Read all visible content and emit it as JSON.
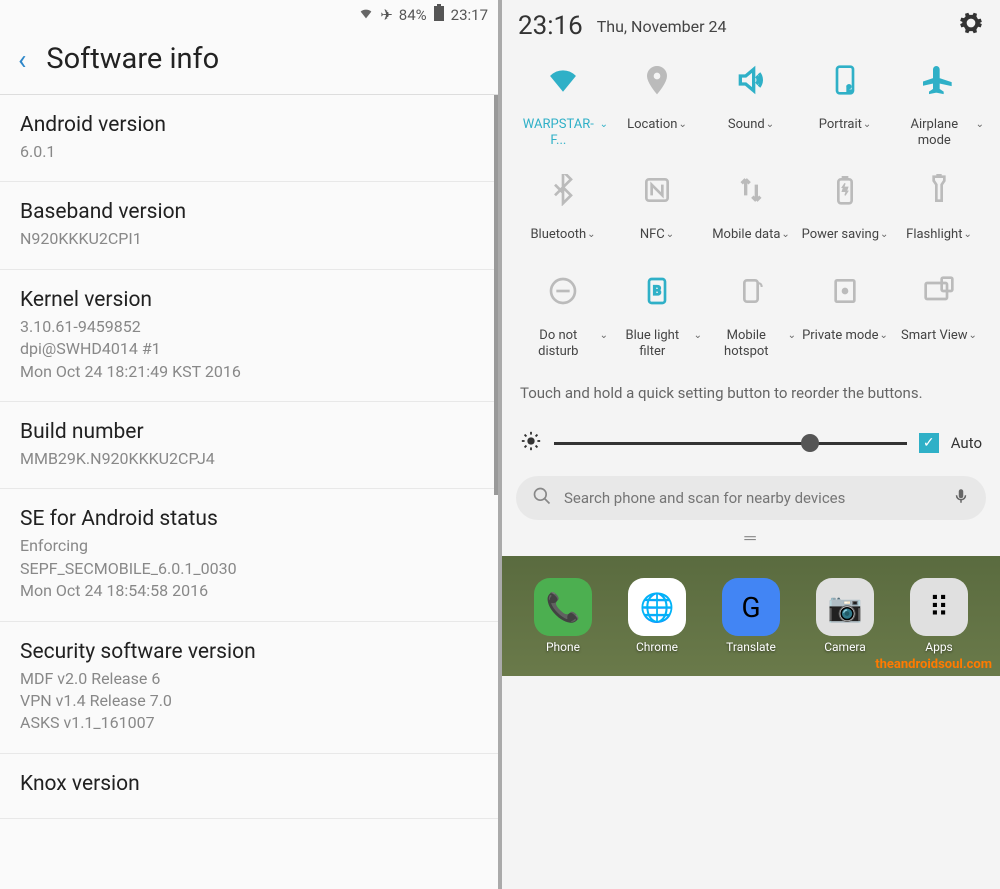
{
  "left": {
    "status": {
      "battery": "84%",
      "time": "23:17"
    },
    "title": "Software info",
    "items": [
      {
        "label": "Android version",
        "value": "6.0.1"
      },
      {
        "label": "Baseband version",
        "value": "N920KKKU2CPI1"
      },
      {
        "label": "Kernel version",
        "value": "3.10.61-9459852\ndpi@SWHD4014 #1\nMon Oct 24 18:21:49 KST 2016"
      },
      {
        "label": "Build number",
        "value": "MMB29K.N920KKKU2CPJ4"
      },
      {
        "label": "SE for Android status",
        "value": "Enforcing\nSEPF_SECMOBILE_6.0.1_0030\nMon Oct 24 18:54:58 2016"
      },
      {
        "label": "Security software version",
        "value": "MDF v2.0 Release 6\nVPN v1.4 Release 7.0\nASKS v1.1_161007"
      },
      {
        "label": "Knox version",
        "value": ""
      }
    ]
  },
  "right": {
    "time": "23:16",
    "date": "Thu, November 24",
    "tiles": [
      [
        {
          "name": "wifi",
          "label": "WARPSTAR-F...",
          "active": true
        },
        {
          "name": "location",
          "label": "Location",
          "active": false
        },
        {
          "name": "sound",
          "label": "Sound",
          "active": true
        },
        {
          "name": "portrait",
          "label": "Portrait",
          "active": true
        },
        {
          "name": "airplane",
          "label": "Airplane mode",
          "active": true
        }
      ],
      [
        {
          "name": "bluetooth",
          "label": "Bluetooth",
          "active": false
        },
        {
          "name": "nfc",
          "label": "NFC",
          "active": false
        },
        {
          "name": "mobile-data",
          "label": "Mobile data",
          "active": false
        },
        {
          "name": "power-saving",
          "label": "Power saving",
          "active": false
        },
        {
          "name": "flashlight",
          "label": "Flashlight",
          "active": false
        }
      ],
      [
        {
          "name": "dnd",
          "label": "Do not disturb",
          "active": false
        },
        {
          "name": "blue-light",
          "label": "Blue light filter",
          "active": true
        },
        {
          "name": "hotspot",
          "label": "Mobile hotspot",
          "active": false
        },
        {
          "name": "private",
          "label": "Private mode",
          "active": false
        },
        {
          "name": "smart-view",
          "label": "Smart View",
          "active": false
        }
      ]
    ],
    "hint": "Touch and hold a quick setting button to reorder the buttons.",
    "brightness": {
      "auto_label": "Auto",
      "value": 70
    },
    "search": {
      "placeholder": "Search phone and scan for nearby devices"
    },
    "home_apps": [
      {
        "name": "phone",
        "label": "Phone",
        "bg": "#4caf50",
        "glyph": "📞"
      },
      {
        "name": "chrome",
        "label": "Chrome",
        "bg": "#fff",
        "glyph": "🌐"
      },
      {
        "name": "translate",
        "label": "Translate",
        "bg": "#4285f4",
        "glyph": "G"
      },
      {
        "name": "camera",
        "label": "Camera",
        "bg": "#e0e0e0",
        "glyph": "📷"
      },
      {
        "name": "apps",
        "label": "Apps",
        "bg": "#e0e0e0",
        "glyph": "⠿"
      }
    ],
    "watermark": "theandroidsoul.com"
  }
}
